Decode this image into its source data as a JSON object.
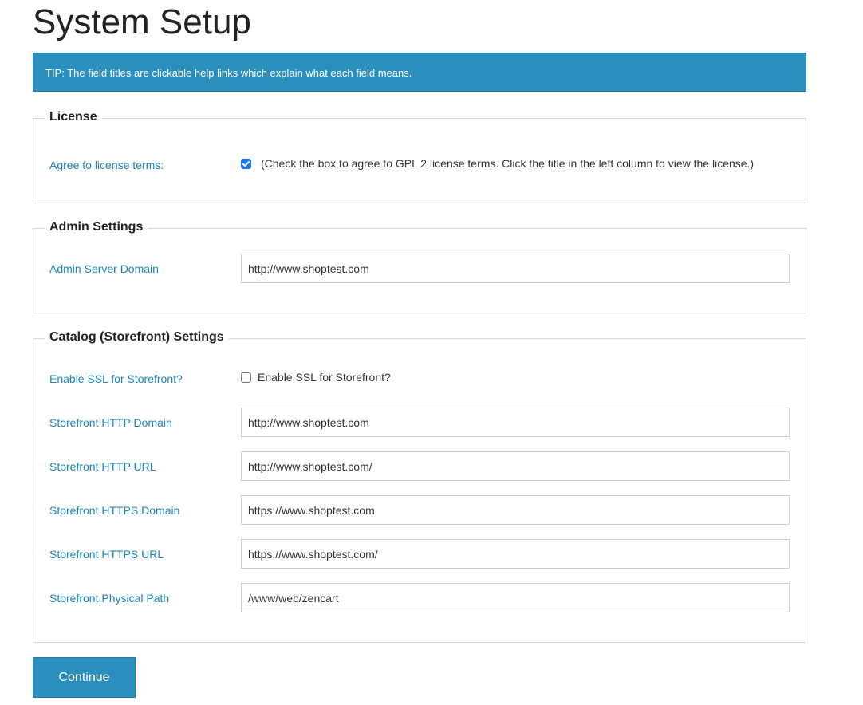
{
  "page": {
    "title": "System Setup",
    "tip": "TIP: The field titles are clickable help links which explain what each field means."
  },
  "license": {
    "legend": "License",
    "agree_label": "Agree to license terms:",
    "agree_checked": true,
    "agree_text": "(Check the box to agree to GPL 2 license terms. Click the title in the left column to view the license.)"
  },
  "admin": {
    "legend": "Admin Settings",
    "server_domain_label": "Admin Server Domain",
    "server_domain_value": "http://www.shoptest.com"
  },
  "catalog": {
    "legend": "Catalog (Storefront) Settings",
    "enable_ssl_label": "Enable SSL for Storefront?",
    "enable_ssl_checked": false,
    "enable_ssl_text": "Enable SSL for Storefront?",
    "http_domain_label": "Storefront HTTP Domain",
    "http_domain_value": "http://www.shoptest.com",
    "http_url_label": "Storefront HTTP URL",
    "http_url_value": "http://www.shoptest.com/",
    "https_domain_label": "Storefront HTTPS Domain",
    "https_domain_value": "https://www.shoptest.com",
    "https_url_label": "Storefront HTTPS URL",
    "https_url_value": "https://www.shoptest.com/",
    "physical_path_label": "Storefront Physical Path",
    "physical_path_value": "/www/web/zencart"
  },
  "actions": {
    "continue_label": "Continue"
  },
  "colors": {
    "accent": "#2a8fbd",
    "link": "#1d86b8",
    "checkbox": "#1a73e8"
  }
}
